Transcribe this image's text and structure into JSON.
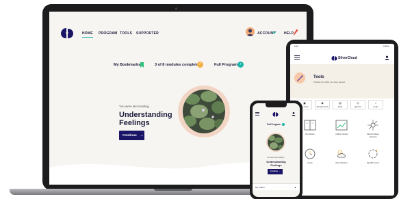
{
  "laptop": {
    "nav": {
      "home": "HOME",
      "program": "PROGRAM",
      "tools": "TOOLS",
      "supporter": "SUPPORTER",
      "account": "ACCOUNT",
      "help": "HELP"
    },
    "modules_bar": {
      "bookmarks": "My Bookmarks",
      "progress": "3 of 8 modules complete",
      "full_program": "Full Program"
    },
    "hero": {
      "reading": "You were last reading...",
      "title_line1": "Understanding",
      "title_line2": "Feelings",
      "continue_label": "Continue"
    }
  },
  "tablet": {
    "brand": "SilverCloud",
    "status_left": "9:41",
    "status_right": "100%",
    "tools_title": "Tools",
    "tools_subtitle": "Practice the skills you have gained",
    "tabs": [
      {
        "label": "My Tools"
      },
      {
        "label": "Thought Tools"
      },
      {
        "label": "Diary"
      },
      {
        "label": "Quizzes"
      },
      {
        "label": "Audio"
      }
    ],
    "grid": [
      {
        "label": "My Diaries"
      },
      {
        "label": "Lifeline Tracker"
      },
      {
        "label": "Mood & Sleep Network"
      },
      {
        "label": "Goals"
      },
      {
        "label": "Mood Monitor"
      },
      {
        "label": "My ABC Cycle"
      }
    ]
  },
  "phone": {
    "full_program": "Full Program",
    "reading": "You were last reading...",
    "title_line1": "Understanding",
    "title_line2": "Feelings",
    "continue_label": "Continue",
    "coach": "My Coach"
  },
  "colors": {
    "navy": "#1a1566",
    "teal": "#1db5a7",
    "green": "#2ec27e",
    "orange": "#f5b041",
    "peach": "#f2d5c4"
  }
}
